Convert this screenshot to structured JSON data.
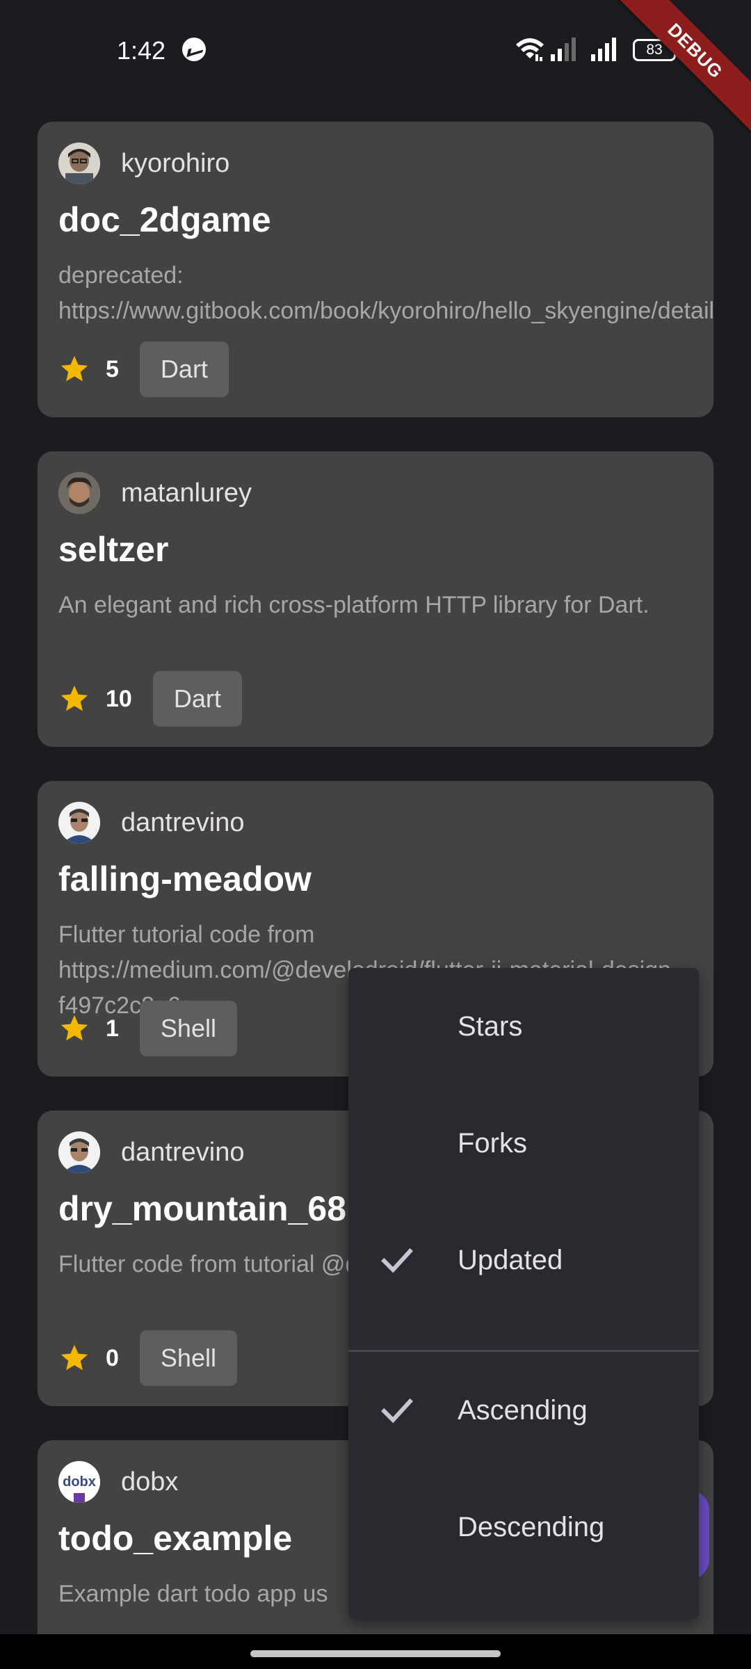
{
  "status_bar": {
    "time": "1:42",
    "battery": "83",
    "debug_label": "DEBUG",
    "icons": [
      "messenger-icon",
      "wifi-icon",
      "cellular-signal-icon",
      "cellular-signal-icon",
      "battery-icon"
    ]
  },
  "repos": [
    {
      "owner": "kyorohiro",
      "name": "doc_2dgame",
      "description": "deprecated: https://www.gitbook.com/book/kyorohiro/hello_skyengine/details",
      "stars": "5",
      "language": "Dart"
    },
    {
      "owner": "matanlurey",
      "name": "seltzer",
      "description": "An elegant and rich cross-platform HTTP library for Dart.",
      "stars": "10",
      "language": "Dart"
    },
    {
      "owner": "dantrevino",
      "name": "falling-meadow",
      "description": "Flutter tutorial code from https://medium.com/@develodroid/flutter-ii-material-design-f497c2c8e6c",
      "stars": "1",
      "language": "Shell"
    },
    {
      "owner": "dantrevino",
      "name": "dry_mountain_68",
      "description": "Flutter code from tutorial @develodroid/flutter-i-int",
      "stars": "0",
      "language": "Shell"
    },
    {
      "owner": "dobx",
      "name": "todo_example",
      "description": "Example dart todo app us",
      "stars": "",
      "language": ""
    }
  ],
  "sort_menu": {
    "items": [
      {
        "label": "Stars",
        "checked": false
      },
      {
        "label": "Forks",
        "checked": false
      },
      {
        "label": "Updated",
        "checked": true
      },
      {
        "label": "Ascending",
        "checked": true
      },
      {
        "label": "Descending",
        "checked": false
      }
    ]
  },
  "colors": {
    "background": "#1c1b20",
    "card": "#434343",
    "chip": "#5e5e5e",
    "star": "#f5b800",
    "menu": "#2b2930",
    "debug_ribbon": "#8d1c1c",
    "fab": "#6b4bc4"
  }
}
